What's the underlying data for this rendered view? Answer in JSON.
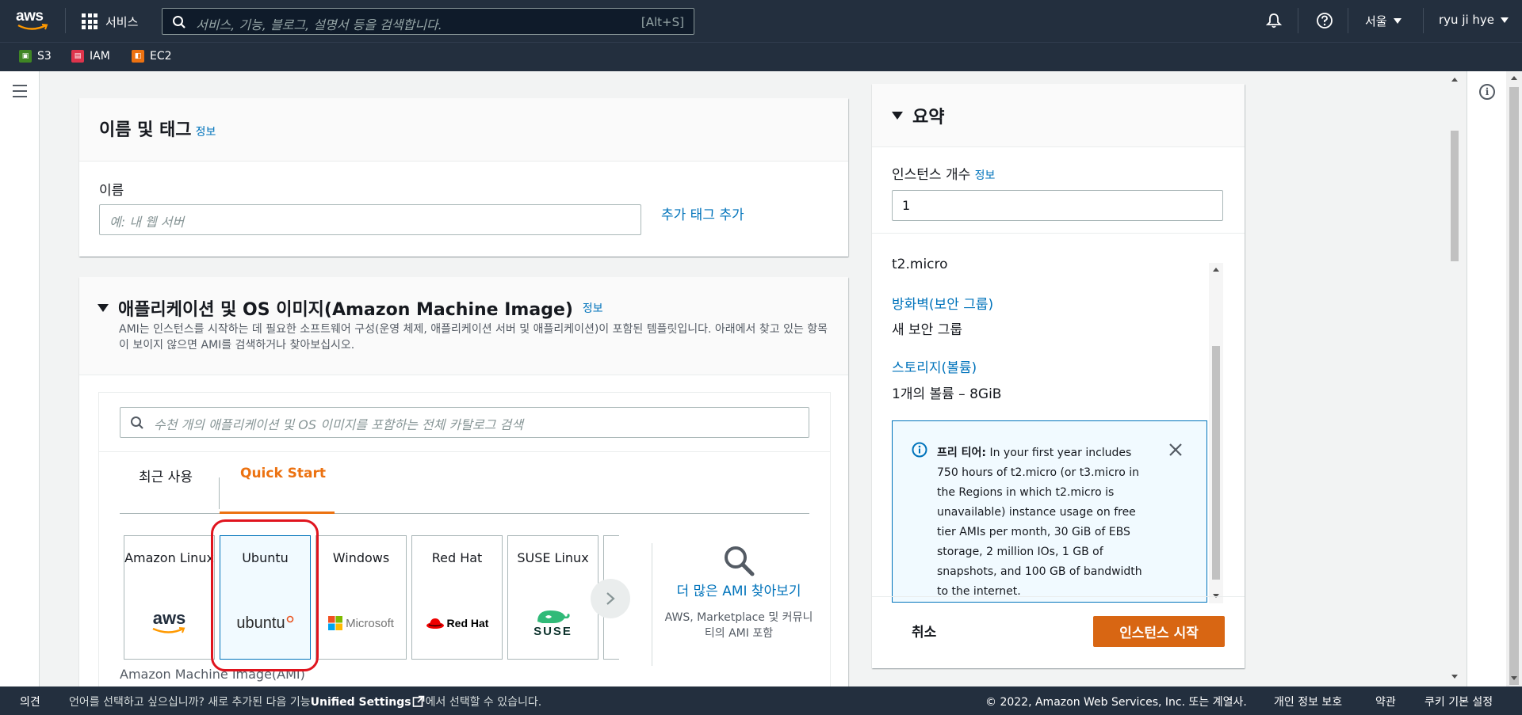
{
  "nav": {
    "logo_text": "aws",
    "services_label": "서비스",
    "search_placeholder": "서비스, 기능, 블로그, 설명서 등을 검색합니다.",
    "search_shortcut": "[Alt+S]",
    "region": "서울",
    "user": "ryu ji hye"
  },
  "favorites": [
    {
      "label": "S3",
      "color": "#3f8624",
      "icon": "s3-icon"
    },
    {
      "label": "IAM",
      "color": "#dd344c",
      "icon": "iam-icon"
    },
    {
      "label": "EC2",
      "color": "#ec7211",
      "icon": "ec2-icon"
    }
  ],
  "name_tags": {
    "title": "이름 및 태그",
    "info": "정보",
    "name_label": "이름",
    "name_placeholder": "예: 내 웹 서버",
    "add_tag": "추가 태그 추가"
  },
  "ami": {
    "title": "애플리케이션 및 OS 이미지(Amazon Machine Image)",
    "info": "정보",
    "description": "AMI는 인스턴스를 시작하는 데 필요한 소프트웨어 구성(운영 체제, 애플리케이션 서버 및 애플리케이션)이 포함된 템플릿입니다. 아래에서 찾고 있는 항목이 보이지 않으면 AMI를 검색하거나 찾아보십시오.",
    "search_placeholder": "수천 개의 애플리케이션 및 OS 이미지를 포함하는 전체 카탈로그 검색",
    "tabs": [
      {
        "label": "최근 사용",
        "active": false
      },
      {
        "label": "Quick Start",
        "active": true
      }
    ],
    "tiles": [
      {
        "name": "Amazon Linux",
        "logo": "aws-logo-icon",
        "logo_text": "aws",
        "selected": false
      },
      {
        "name": "Ubuntu",
        "logo": "ubuntu-logo-icon",
        "logo_text": "ubuntu",
        "selected": true
      },
      {
        "name": "Windows",
        "logo": "microsoft-logo-icon",
        "logo_text": "Microsoft",
        "selected": false
      },
      {
        "name": "Red Hat",
        "logo": "redhat-logo-icon",
        "logo_text": "Red Hat",
        "selected": false
      },
      {
        "name": "SUSE Linux",
        "logo": "suse-logo-icon",
        "logo_text": "SUSE",
        "selected": false
      }
    ],
    "browse_more": "더 많은 AMI 찾아보기",
    "browse_sub": "AWS, Marketplace 및 커뮤니티의 AMI 포함",
    "ami_label": "Amazon Machine Image(AMI)"
  },
  "summary": {
    "title": "요약",
    "count_label": "인스턴스 개수",
    "info": "정보",
    "count_value": "1",
    "instance_type": "t2.micro",
    "firewall_link": "방화벽(보안 그룹)",
    "firewall_value": "새 보안 그룹",
    "storage_link": "스토리지(볼륨)",
    "storage_value": "1개의 볼륨 – 8GiB",
    "free_tier_label": "프리 티어:",
    "free_tier_text": "In your first year includes 750 hours of t2.micro (or t3.micro in the Regions in which t2.micro is unavailable) instance usage on free tier AMIs per month, 30 GiB of EBS storage, 2 million IOs, 1 GB of snapshots, and 100 GB of bandwidth to the internet.",
    "cancel": "취소",
    "launch": "인스턴스 시작"
  },
  "footer": {
    "feedback": "의견",
    "lang_msg_1": "언어를 선택하고 싶으십니까? 새로 추가된 다음 기능",
    "lang_msg_link": "Unified Settings",
    "lang_msg_2": "에서 선택할 수 있습니다.",
    "copyright": "© 2022, Amazon Web Services, Inc. 또는 계열사.",
    "privacy": "개인 정보 보호",
    "terms": "약관",
    "cookies": "쿠키 기본 설정"
  }
}
